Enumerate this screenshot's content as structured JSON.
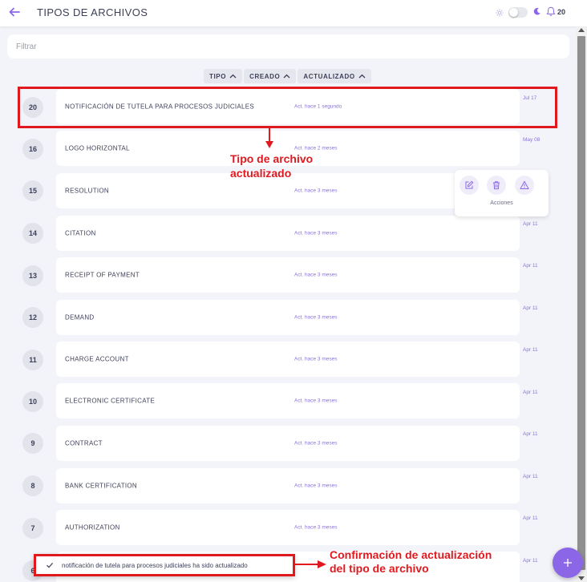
{
  "header": {
    "title": "TIPOS DE ARCHIVOS",
    "notification_count": "20",
    "back_icon": "arrow-left-icon",
    "accent_color": "#8b67e8"
  },
  "filter": {
    "placeholder": "Filtrar"
  },
  "sort": [
    {
      "label": "TIPO"
    },
    {
      "label": "CREADO"
    },
    {
      "label": "ACTUALIZADO"
    }
  ],
  "rows": [
    {
      "id": "20",
      "name": "NOTIFICACIÓN DE TUTELA PARA PROCESOS JUDICIALES",
      "updated": "Act. hace 1 segundo",
      "date": "Jul 17"
    },
    {
      "id": "16",
      "name": "LOGO HORIZONTAL",
      "updated": "Act. hace 2 meses",
      "date": "May 08"
    },
    {
      "id": "15",
      "name": "RESOLUTION",
      "updated": "Act. hace 3 meses",
      "date": ""
    },
    {
      "id": "14",
      "name": "CITATION",
      "updated": "Act. hace 3 meses",
      "date": "Apr 11"
    },
    {
      "id": "13",
      "name": "RECEIPT OF PAYMENT",
      "updated": "Act. hace 3 meses",
      "date": "Apr 11"
    },
    {
      "id": "12",
      "name": "DEMAND",
      "updated": "Act. hace 3 meses",
      "date": "Apr 11"
    },
    {
      "id": "11",
      "name": "CHARGE ACCOUNT",
      "updated": "Act. hace 3 meses",
      "date": "Apr 11"
    },
    {
      "id": "10",
      "name": "ELECTRONIC CERTIFICATE",
      "updated": "Act. hace 3 meses",
      "date": "Apr 11"
    },
    {
      "id": "9",
      "name": "CONTRACT",
      "updated": "Act. hace 3 meses",
      "date": "Apr 11"
    },
    {
      "id": "8",
      "name": "BANK CERTIFICATION",
      "updated": "Act. hace 3 meses",
      "date": "Apr 11"
    },
    {
      "id": "7",
      "name": "AUTHORIZATION",
      "updated": "Act. hace 3 meses",
      "date": "Apr 11"
    },
    {
      "id": "6",
      "name": "",
      "updated": "",
      "date": "Apr 11"
    }
  ],
  "actions_popup": {
    "label": "Acciones",
    "icons": [
      "edit-icon",
      "trash-icon",
      "warning-icon"
    ]
  },
  "annotations": {
    "updated_type": "Tipo de archivo actualizado",
    "confirmation": "Confirmación de actualización del tipo de archivo"
  },
  "toast": {
    "message": "notificación de tutela para procesos judiciales ha sido actualizado"
  }
}
